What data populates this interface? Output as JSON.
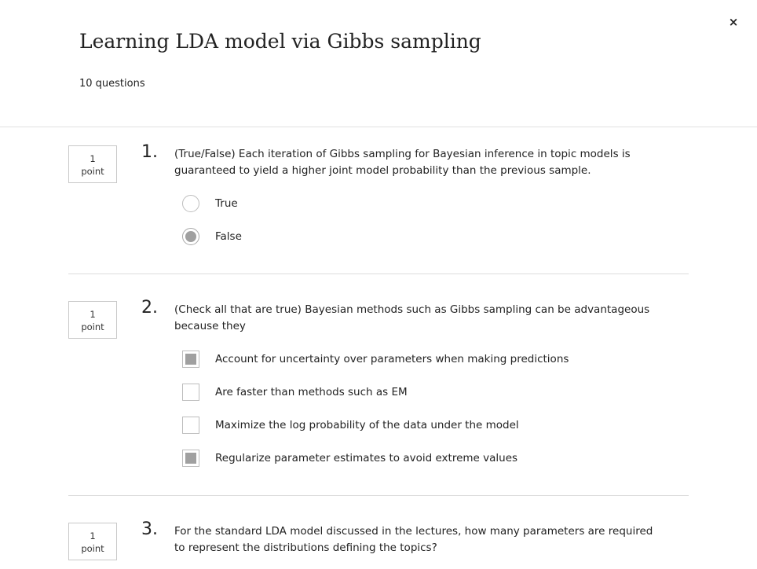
{
  "quiz": {
    "title": "Learning LDA model via Gibbs sampling",
    "question_count": "10 questions",
    "close_label": "×"
  },
  "questions": [
    {
      "number": "1.",
      "points_value": "1",
      "points_unit": "point",
      "text": "(True/False) Each iteration of Gibbs sampling for Bayesian inference in topic models is guaranteed to yield a higher joint model probability than the previous sample.",
      "type": "radio",
      "options": [
        {
          "label": "True",
          "selected": false
        },
        {
          "label": "False",
          "selected": true
        }
      ]
    },
    {
      "number": "2.",
      "points_value": "1",
      "points_unit": "point",
      "text": "(Check all that are true) Bayesian methods such as Gibbs sampling can be advantageous because they",
      "type": "checkbox",
      "options": [
        {
          "label": "Account for uncertainty over parameters when making predictions",
          "selected": true
        },
        {
          "label": "Are faster than methods such as EM",
          "selected": false
        },
        {
          "label": "Maximize the log probability of the data under the model",
          "selected": false
        },
        {
          "label": "Regularize parameter estimates to avoid extreme values",
          "selected": true
        }
      ]
    },
    {
      "number": "3.",
      "points_value": "1",
      "points_unit": "point",
      "text": "For the standard LDA model discussed in the lectures, how many parameters are required to represent the distributions defining the topics?",
      "type": "text",
      "options": []
    }
  ],
  "colors": {
    "selected_fill": "#a0a0a0",
    "control_border": "#bdbdbd",
    "divider": "#dddddd"
  }
}
